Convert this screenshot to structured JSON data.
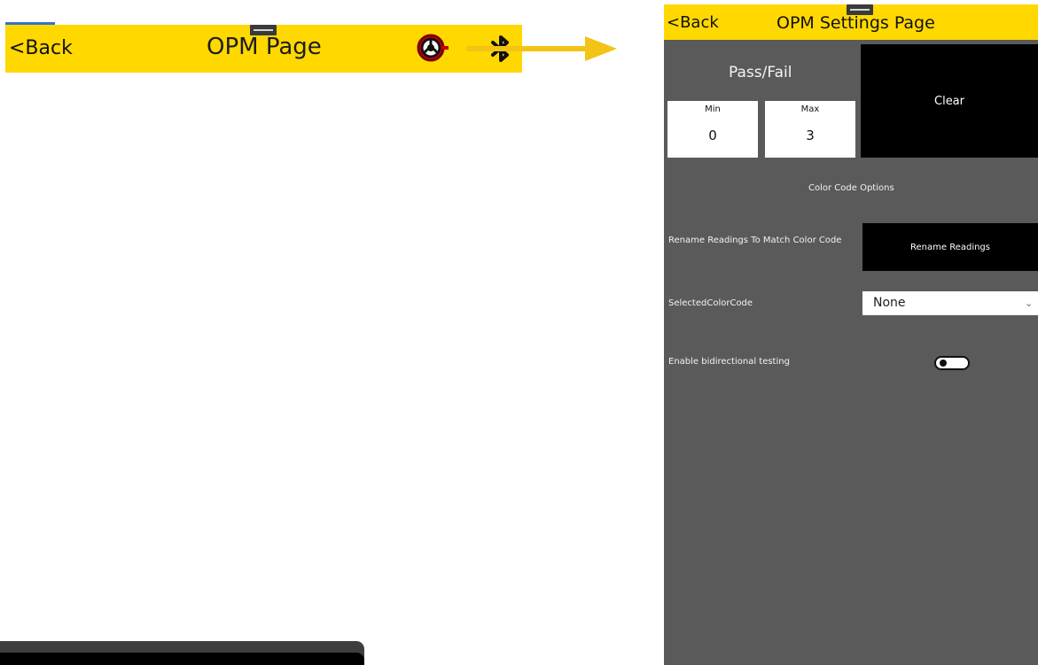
{
  "left_screen": {
    "back_label": "<Back",
    "title": "OPM Page",
    "icons": [
      "steering-wheel-icon",
      "bluetooth-icon"
    ]
  },
  "right_screen": {
    "back_label": "<Back",
    "title": "OPM Settings Page",
    "pass_fail": {
      "label": "Pass/Fail",
      "min_label": "Min",
      "min_value": "0",
      "max_label": "Max",
      "max_value": "3"
    },
    "clear_button": "Clear",
    "section_title": "Color Code Options",
    "rename_label": "Rename Readings To Match Color Code",
    "rename_button": "Rename Readings",
    "selected_color_label": "SelectedColorCode",
    "selected_color_value": "None",
    "bidirectional_label": "Enable bidirectional testing",
    "bidirectional_enabled": false
  },
  "colors": {
    "accent_yellow": "#ffd800",
    "panel_gray": "#5a5a5a"
  }
}
